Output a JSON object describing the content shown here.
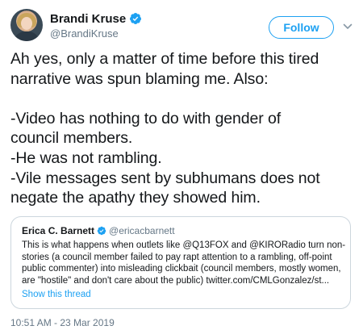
{
  "author": {
    "display_name": "Brandi Kruse",
    "handle": "@BrandiKruse"
  },
  "follow_label": "Follow",
  "tweet_lines": [
    "Ah yes, only a matter of time before this tired",
    "narrative was spun blaming me. Also:",
    "",
    "-Video has nothing to do with gender of",
    "council members.",
    "-He was not rambling.",
    "-Vile messages sent by subhumans does not",
    "negate the apathy they showed him."
  ],
  "quoted_tweet": {
    "display_name": "Erica C. Barnett",
    "handle": "@ericacbarnett",
    "text_lines": [
      "This is what happens when outlets like @Q13FOX and @KIRORadio turn non-",
      "stories (a council member failed to pay rapt attention to a rambling, off-point",
      "public commenter) into misleading clickbait (council members, mostly women,",
      "are \"hostile\" and don't care about the public) twitter.com/CMLGonzalez/st..."
    ],
    "show_thread": "Show this thread"
  },
  "timestamp": "10:51 AM - 23 Mar 2019",
  "colors": {
    "accent": "#1da1f2",
    "secondary_text": "#657786",
    "border": "#ccd6dd"
  },
  "icons": {
    "verified": "verified-badge-icon",
    "more": "chevron-down-icon"
  }
}
